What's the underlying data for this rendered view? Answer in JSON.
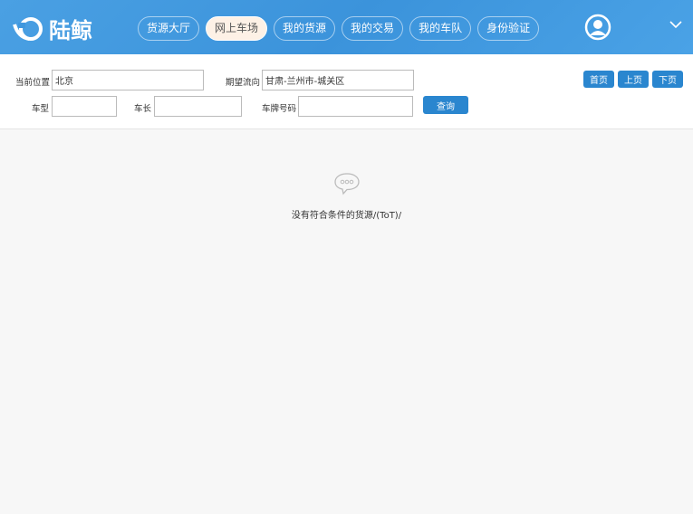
{
  "brand": {
    "name": "陆鲸"
  },
  "nav": [
    {
      "label": "货源大厅"
    },
    {
      "label": "网上车场",
      "active": true
    },
    {
      "label": "我的货源"
    },
    {
      "label": "我的交易"
    },
    {
      "label": "我的车队"
    },
    {
      "label": "身份验证"
    }
  ],
  "form": {
    "location_label": "当前位置",
    "location_value": "北京",
    "direction_label": "期望流向",
    "direction_value": "甘肃-兰州市-城关区",
    "type_label": "车型",
    "type_value": "",
    "length_label": "车长",
    "length_value": "",
    "plate_label": "车牌号码",
    "plate_value": "",
    "search_label": "查询"
  },
  "pager": {
    "first": "首页",
    "prev": "上页",
    "next": "下页"
  },
  "empty": {
    "message": "没有符合条件的货源/(ToT)/"
  },
  "colors": {
    "header": "#3b93db",
    "button": "#2a86cf"
  }
}
